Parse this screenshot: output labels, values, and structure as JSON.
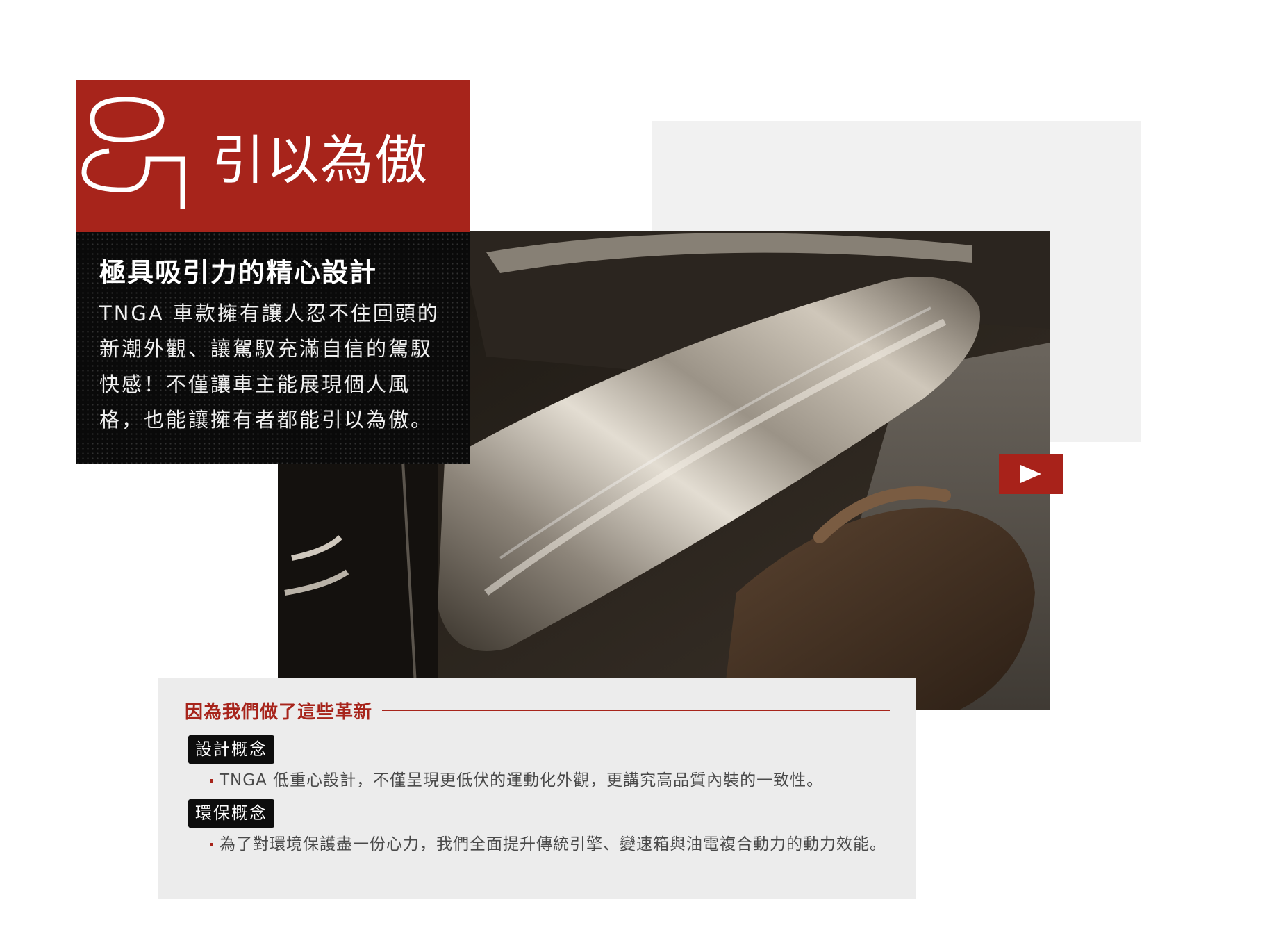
{
  "header": {
    "number": "05",
    "title": "引以為傲"
  },
  "intro": {
    "heading": "極具吸引力的精心設計",
    "body": "TNGA 車款擁有讓人忍不住回頭的新潮外觀、讓駕馭充滿自信的駕馭快感！不僅讓車主能展現個人風格，也能讓擁有者都能引以為傲。"
  },
  "video": {
    "play_icon": "play-icon"
  },
  "innovations": {
    "heading": "因為我們做了這些革新",
    "items": [
      {
        "tag": "設計概念",
        "text": "TNGA 低重心設計，不僅呈現更低伏的運動化外觀，更講究高品質內裝的一致性。"
      },
      {
        "tag": "環保概念",
        "text": "為了對環境保護盡一份心力，我們全面提升傳統引擎、變速箱與油電複合動力的動力效能。"
      }
    ]
  },
  "colors": {
    "accent": "#a7241b",
    "panel": "#ececec",
    "dark": "#0a0a0a"
  }
}
